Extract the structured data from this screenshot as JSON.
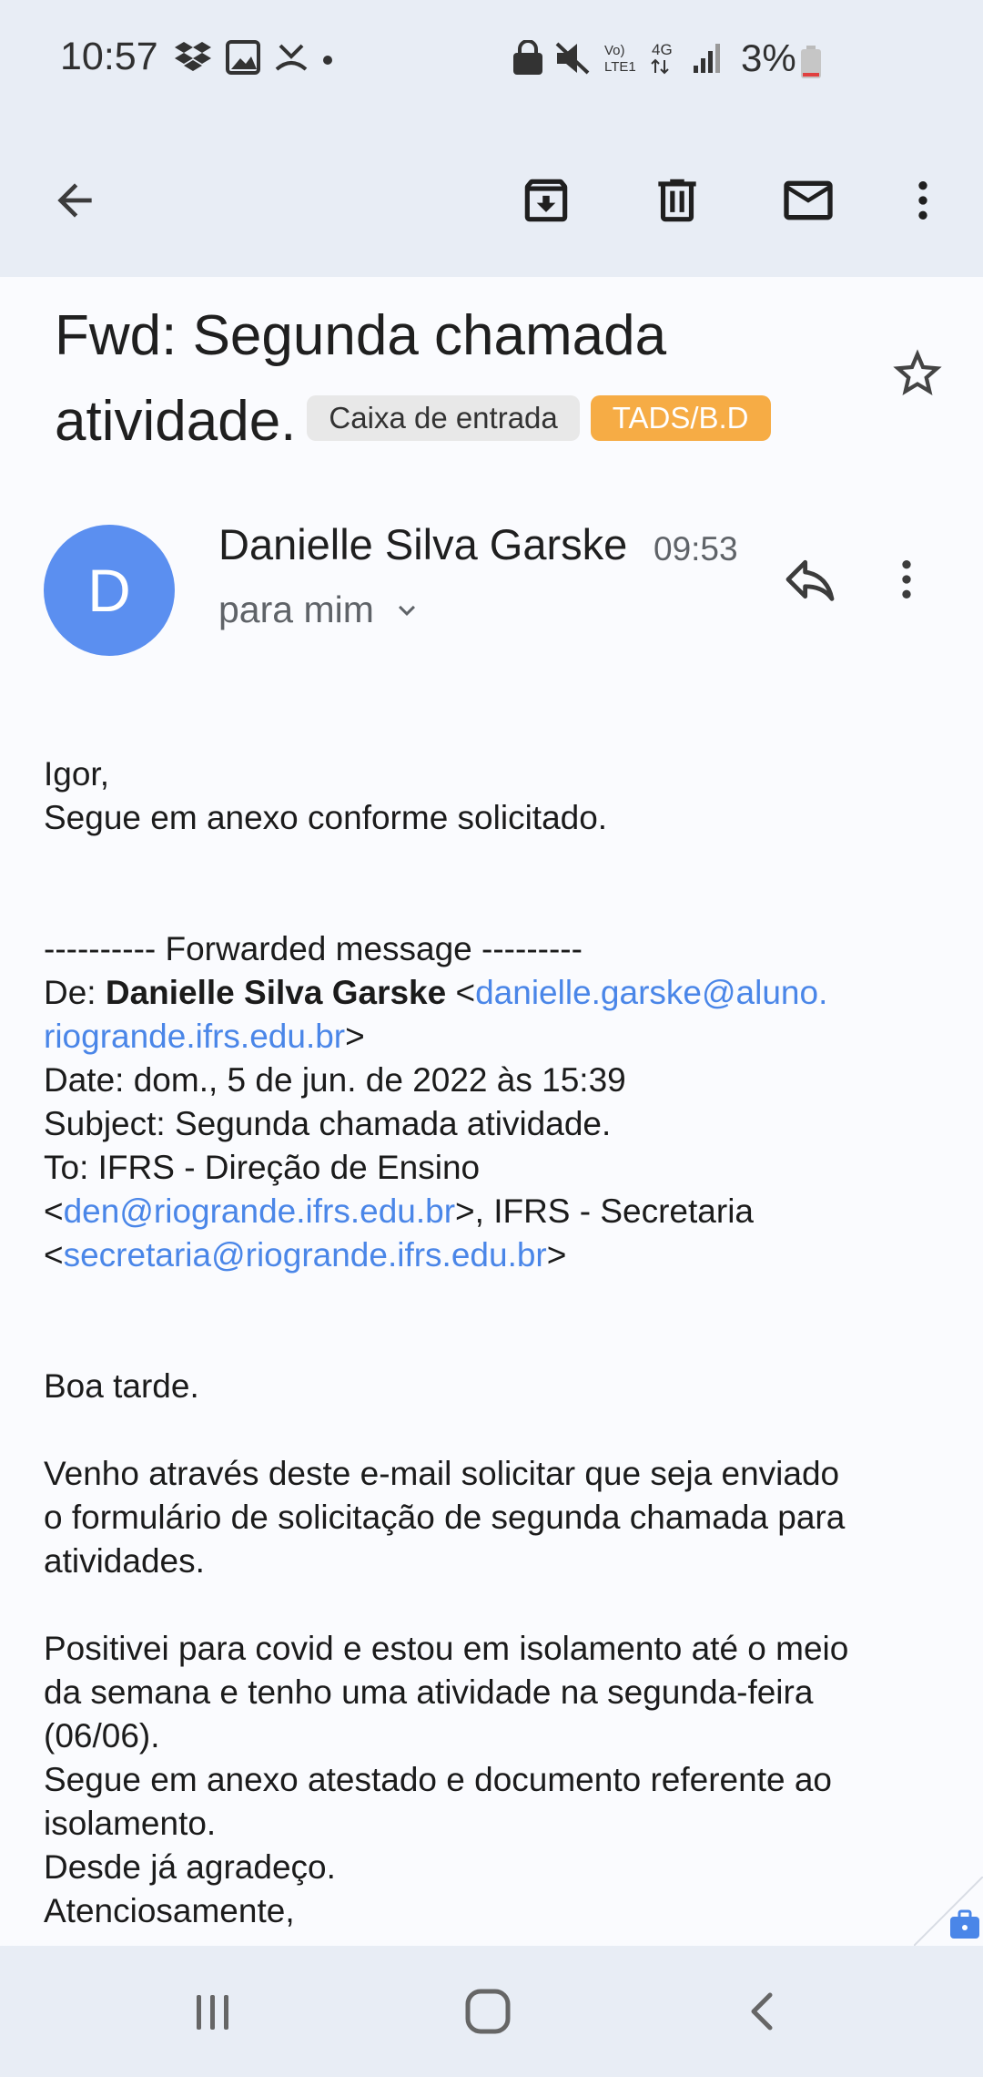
{
  "status_bar": {
    "time": "10:57",
    "battery_pct": "3%",
    "left_icons": [
      "dropbox-icon",
      "image-icon",
      "missed-call-icon",
      "dot-icon"
    ],
    "right_icons": [
      "lock-icon",
      "mute-icon",
      "volte-icon",
      "4g-icon",
      "signal-icon",
      "battery-icon"
    ],
    "volte_label_top": "Vo)",
    "volte_label_bottom": "LTE1",
    "network_label": "4G"
  },
  "toolbar": {
    "icons": [
      "back-arrow-icon",
      "archive-icon",
      "delete-icon",
      "mail-icon",
      "more-vert-icon"
    ]
  },
  "email": {
    "subject_line1": "Fwd: Segunda chamada",
    "subject_line2": "atividade.",
    "chips": [
      "Caixa de entrada",
      "TADS/B.D"
    ],
    "chip_colors": {
      "inbox": "#e8e8e8",
      "label": "#f6ac45"
    },
    "sender_initial": "D",
    "avatar_color": "#5b8ff0",
    "sender_name": "Danielle Silva Garske",
    "time": "09:53",
    "recipient": "para mim"
  },
  "body": {
    "greeting": "Igor,",
    "intro": "Segue em anexo conforme solicitado.",
    "fwd_header": "---------- Forwarded message ---------",
    "from_label": "De: ",
    "from_name": "Danielle Silva Garske",
    "from_email_line1": "danielle.garske@aluno.",
    "from_email_line2": "riogrande.ifrs.edu.br",
    "date_line": "Date: dom., 5 de jun. de 2022 às 15:39",
    "subject_line": "Subject: Segunda chamada atividade.",
    "to_line": "To: IFRS - Direção de Ensino",
    "to_email1": "den@riogrande.ifrs.edu.br",
    "to_mid": ">, IFRS - Secretaria",
    "to_email2": "secretaria@riogrande.ifrs.edu.br",
    "salutation": "Boa tarde.",
    "para1_l1": "Venho através deste e-mail solicitar que seja enviado",
    "para1_l2": "o formulário de solicitação de segunda chamada para",
    "para1_l3": "atividades.",
    "para2_l1": "Positivei para covid e estou em isolamento até o meio",
    "para2_l2": "da semana e tenho uma atividade na segunda-feira",
    "para2_l3": "(06/06).",
    "para3_l1": "Segue em anexo atestado e documento referente ao",
    "para3_l2": "isolamento.",
    "thanks": "Desde já agradeço.",
    "closing": "Atenciosamente,"
  },
  "link_color": "#4a86e8",
  "nav_bar": {
    "icons": [
      "recent-apps-icon",
      "home-icon",
      "back-icon"
    ]
  }
}
